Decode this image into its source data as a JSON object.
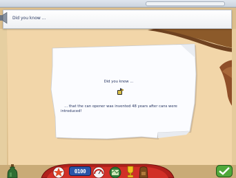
{
  "header": {
    "title": "Did you know ..."
  },
  "note": {
    "heading": "Did you know ...",
    "icon": "can-opener-icon",
    "fact_line1": "... that the can opener was invented 48 years after cans were",
    "fact_line2": "introduced!"
  },
  "toolbar": {
    "clock": "0100",
    "items": [
      "potion-bottle-icon",
      "star-icon",
      "clock-display",
      "gauge-icon",
      "map-icon",
      "trophy-icon",
      "backpack-icon",
      "checkmark-icon"
    ]
  },
  "colors": {
    "sand": "#dcbf8d",
    "beige_panel": "#f2d6a9",
    "paper": "#fbfcff",
    "text_navy": "#23325f",
    "toolbar_red": "#b0211c",
    "check_green": "#4fa83a"
  }
}
